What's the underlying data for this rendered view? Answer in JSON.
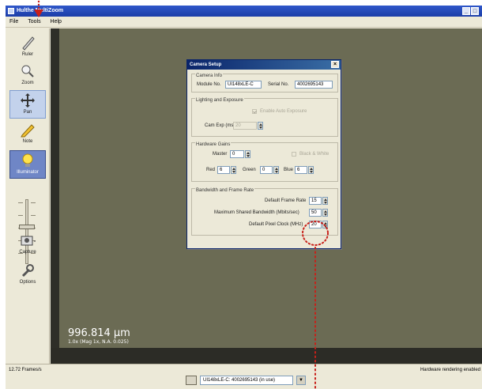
{
  "app": {
    "title": "Hulthe MultiZoom"
  },
  "menu": {
    "file": "File",
    "tools": "Tools",
    "help": "Help"
  },
  "tools": {
    "ruler": "Ruler",
    "zoom": "Zoom",
    "pan": "Pan",
    "note": "Note",
    "illuminator": "Illuminator",
    "capture": "Capture",
    "options": "Options"
  },
  "scale": {
    "value": "996.814 µm",
    "detail": "1.0x (Mag 1x, N.A. 0.025)"
  },
  "status": {
    "fps": "12.72 Frames/s",
    "rendering": "Hardware rendering enabled",
    "camera_select": "UI148xLE-C: 4002695143 (in use)"
  },
  "dialog": {
    "title": "Camera Setup",
    "camera_info": {
      "group": "Camera Info",
      "module_label": "Module No.",
      "module_value": "UI148xLE-C",
      "serial_label": "Serial No.",
      "serial_value": "4002695143"
    },
    "lighting": {
      "group": "Lighting and Exposure",
      "auto_exposure": "Enable Auto Exposure",
      "cam_exp_label": "Cam Exp (ms)",
      "cam_exp_value": "20"
    },
    "gains": {
      "group": "Hardware Gains",
      "master_label": "Master",
      "master_value": "0",
      "bw_label": "Black & White",
      "red_label": "Red",
      "red_value": "6",
      "green_label": "Green",
      "green_value": "0",
      "blue_label": "Blue",
      "blue_value": "6"
    },
    "bandwidth": {
      "group": "Bandwidth and Frame Rate",
      "fps_label": "Default Frame Rate",
      "fps_value": "15",
      "bw_label": "Maximum Shared Bandwidth (Mbits/sec)",
      "bw_value": "50",
      "clock_label": "Default Pixel Clock (MHz)",
      "clock_value": "20"
    }
  },
  "colors": {
    "annotation": "#c8201a",
    "viewport": "#6b6b54",
    "titlebar": "#2f57c9"
  }
}
